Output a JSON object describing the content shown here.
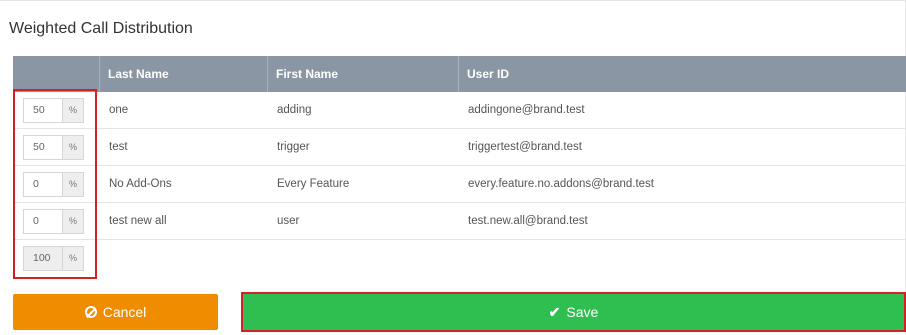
{
  "title": "Weighted Call Distribution",
  "table": {
    "columns": [
      "",
      "Last Name",
      "First Name",
      "User ID"
    ],
    "rows": [
      {
        "weight": "50",
        "unit": "%",
        "last_name": "one",
        "first_name": "adding",
        "user_id": "addingone@brand.test"
      },
      {
        "weight": "50",
        "unit": "%",
        "last_name": "test",
        "first_name": "trigger",
        "user_id": "triggertest@brand.test"
      },
      {
        "weight": "0",
        "unit": "%",
        "last_name": "No Add-Ons",
        "first_name": "Every Feature",
        "user_id": "every.feature.no.addons@brand.test"
      },
      {
        "weight": "0",
        "unit": "%",
        "last_name": "test new all",
        "first_name": "user",
        "user_id": "test.new.all@brand.test"
      }
    ],
    "total": {
      "weight": "100",
      "unit": "%"
    }
  },
  "buttons": {
    "cancel_label": "Cancel",
    "save_label": "Save"
  },
  "colors": {
    "header_bg": "#8a96a3",
    "cancel": "#f08c00",
    "save": "#2fbf50",
    "highlight": "#d41f26"
  },
  "icons": {
    "cancel": "ban-icon",
    "save": "check-icon"
  }
}
